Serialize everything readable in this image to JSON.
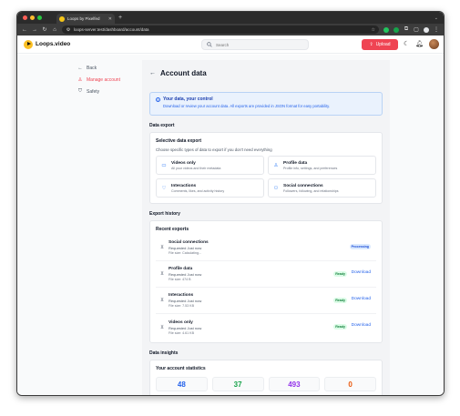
{
  "browser": {
    "tab_title": "Loops by Pixelfed",
    "url": "loops-server.test/dashboard/account/data"
  },
  "header": {
    "brand": "Loops.video",
    "search_placeholder": "Search",
    "upload_label": "Upload"
  },
  "sidebar": {
    "back_label": "Back",
    "items": [
      {
        "label": "Manage account",
        "icon": "user-icon",
        "active": true
      },
      {
        "label": "Safety",
        "icon": "shield-icon",
        "active": false
      }
    ]
  },
  "page": {
    "title": "Account data",
    "info": {
      "title": "Your data, your control",
      "text": "Download or review your account data. All exports are provided in JSON format for easy portability."
    },
    "data_export": {
      "section_label": "Data export",
      "card_title": "Selective data export",
      "card_sub": "Choose specific types of data to export if you don't need everything",
      "options": [
        {
          "title": "Videos only",
          "desc": "All your videos and their metadata",
          "icon": "video-icon"
        },
        {
          "title": "Profile data",
          "desc": "Profile info, settings, and preferences",
          "icon": "person-icon"
        },
        {
          "title": "Interactions",
          "desc": "Comments, likes, and activity history",
          "icon": "heart-icon"
        },
        {
          "title": "Social connections",
          "desc": "Followers, following, and relationships",
          "icon": "people-icon"
        }
      ]
    },
    "export_history": {
      "section_label": "Export history",
      "card_title": "Recent exports",
      "exports": [
        {
          "title": "Social connections",
          "requested": "Requested Just now",
          "size": "File size: Calculating...",
          "status": "Processing",
          "action": ""
        },
        {
          "title": "Profile data",
          "requested": "Requested Just now",
          "size": "File size: 474 B",
          "status": "Ready",
          "action": "Download"
        },
        {
          "title": "Interactions",
          "requested": "Requested Just now",
          "size": "File size: 7.53 KB",
          "status": "Ready",
          "action": "Download"
        },
        {
          "title": "Videos only",
          "requested": "Requested Just now",
          "size": "File size: 4.61 KB",
          "status": "Ready",
          "action": "Download"
        }
      ]
    },
    "insights": {
      "section_label": "Data insights",
      "card_title": "Your account statistics",
      "stats": [
        {
          "value": "48",
          "color": "#2563eb"
        },
        {
          "value": "37",
          "color": "#16a34a"
        },
        {
          "value": "493",
          "color": "#9333ea"
        },
        {
          "value": "0",
          "color": "#ea580c"
        }
      ]
    }
  }
}
